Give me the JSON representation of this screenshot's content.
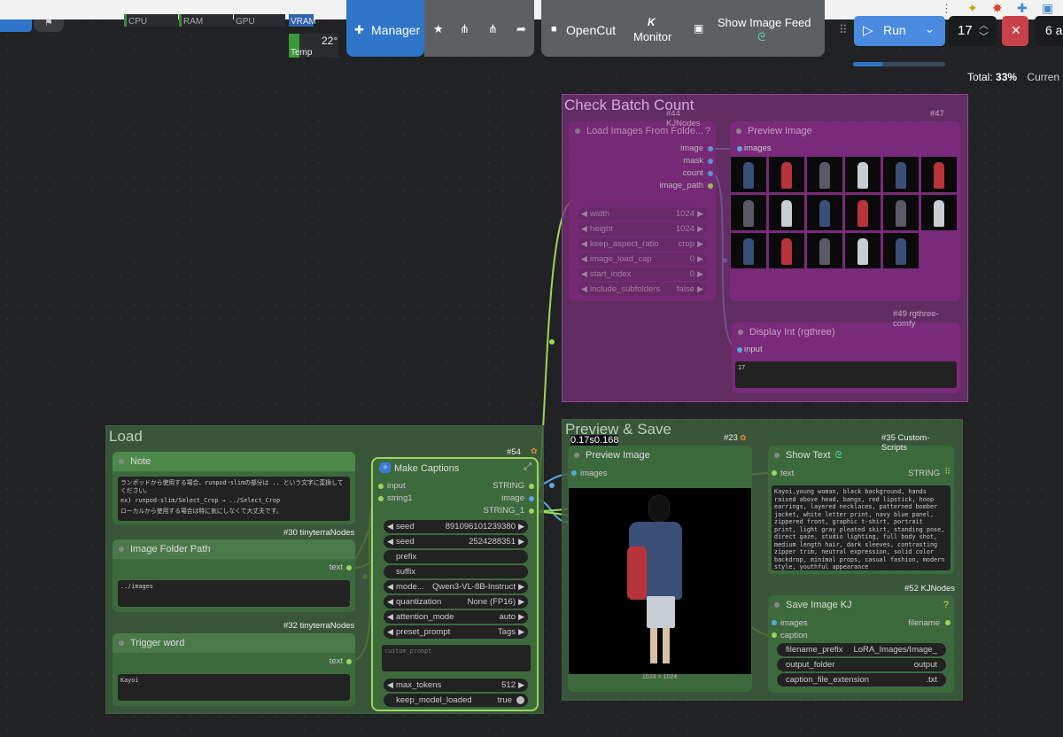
{
  "toolbar": {
    "stats": {
      "cpu": "CPU",
      "ram": "RAM",
      "gpu": "GPU",
      "vram": "VRAM",
      "temp_value": "22°",
      "temp_label": "Temp"
    },
    "manager": "Manager",
    "opencut": "OpenCut",
    "monitor": "Monitor",
    "monitor_glyph": "K",
    "show_feed": "Show Image Feed",
    "run": "Run",
    "batch_count": "17",
    "extra": "6 a",
    "total_label": "Total:",
    "total_value": "33%",
    "current_label": "Curren",
    "progress": 0.33
  },
  "groups": {
    "check_batch": "Check Batch Count",
    "load": "Load",
    "preview_save": "Preview & Save"
  },
  "nodes": {
    "load_images": {
      "title": "Load Images From Folde...",
      "badge": "#44 KJNodes",
      "outputs": [
        "image",
        "mask",
        "count",
        "image_path"
      ],
      "widgets": [
        {
          "label": "width",
          "value": "1024"
        },
        {
          "label": "height",
          "value": "1024"
        },
        {
          "label": "keep_aspect_ratio",
          "value": "crop"
        },
        {
          "label": "image_load_cap",
          "value": "0"
        },
        {
          "label": "start_index",
          "value": "0"
        },
        {
          "label": "include_subfolders",
          "value": "false"
        }
      ]
    },
    "preview_image_top": {
      "title": "Preview Image",
      "badge": "#47",
      "input": "images"
    },
    "display_int": {
      "title": "Display Int (rgthree)",
      "badge": "#49 rgthree-comfy",
      "input": "input",
      "value": "17"
    },
    "note": {
      "title": "Note",
      "badge": "#30 tinyterraNodes",
      "text_lines": [
        "ランポッドから使用する場合、runpod-slimの部分は .. という文字に変換してください。",
        "ex) runpod-slim/Select_Crop → ../Select_Crop",
        "ローカルから使用する場合は特に気にしなくて大丈夫です。"
      ]
    },
    "image_folder": {
      "title": "Image Folder Path",
      "badge": "#32 tinyterraNodes",
      "output": "text",
      "value": "../images"
    },
    "trigger": {
      "title": "Trigger word",
      "output": "text",
      "value": "Kayoi"
    },
    "make_captions": {
      "title": "Make Captions",
      "badge": "#54",
      "inputs": [
        "input",
        "string1"
      ],
      "outputs": [
        "STRING",
        "image",
        "STRING_1"
      ],
      "widgets": [
        {
          "label": "seed",
          "value": "891096101239380",
          "arrows": true
        },
        {
          "label": "seed",
          "value": "2524288351",
          "arrows": true
        },
        {
          "label": "prefix",
          "value": "",
          "arrows": false
        },
        {
          "label": "suffix",
          "value": "",
          "arrows": false
        },
        {
          "label": "mode...",
          "value": "Qwen3-VL-8B-Instruct",
          "arrows": true
        },
        {
          "label": "quantization",
          "value": "None (FP16)",
          "arrows": true
        },
        {
          "label": "attention_mode",
          "value": "auto",
          "arrows": true
        },
        {
          "label": "preset_prompt",
          "value": "Tags",
          "arrows": true
        }
      ],
      "custom_prompt_placeholder": "custom_prompt",
      "max_tokens": {
        "label": "max_tokens",
        "value": "512"
      },
      "keep_loaded": {
        "label": "keep_model_loaded",
        "value": "true"
      }
    },
    "preview_image_main": {
      "title": "Preview Image",
      "badge": "#23",
      "timing": "0.17s0.168",
      "input": "images",
      "dims": "1024 × 1024"
    },
    "show_text": {
      "title": "Show Text",
      "badge": "#35 Custom-Scripts",
      "input": "text",
      "output": "STRING",
      "text": "Kayoi,young woman, black background, hands raised above head, bangs, red lipstick, hoop earrings, layered necklaces, patterned bomber jacket, white letter print, navy blue panel, zippered front, graphic t-shirt, portrait print, light gray pleated skirt, standing pose, direct gaze, studio lighting, full body shot, medium length hair, dark sleeves, contrasting zipper trim, neutral expression, solid color backdrop, minimal props, casual fashion, modern style, youthful appearance"
    },
    "save_image": {
      "title": "Save Image KJ",
      "badge": "#52 KJNodes",
      "help": "?",
      "inputs": [
        "images",
        "caption"
      ],
      "output": "filename",
      "widgets": [
        {
          "label": "filename_prefix",
          "value": "LoRA_Images/Image_"
        },
        {
          "label": "output_folder",
          "value": "output"
        },
        {
          "label": "caption_file_extension",
          "value": ".txt"
        }
      ]
    }
  },
  "colors": {
    "accent": "#2f75c9",
    "group_green": "#3e5f3e",
    "group_purple": "#6a2d6a",
    "link_green": "#9ad85a",
    "link_blue": "#5aa8e0",
    "close_red": "#c9424a"
  }
}
